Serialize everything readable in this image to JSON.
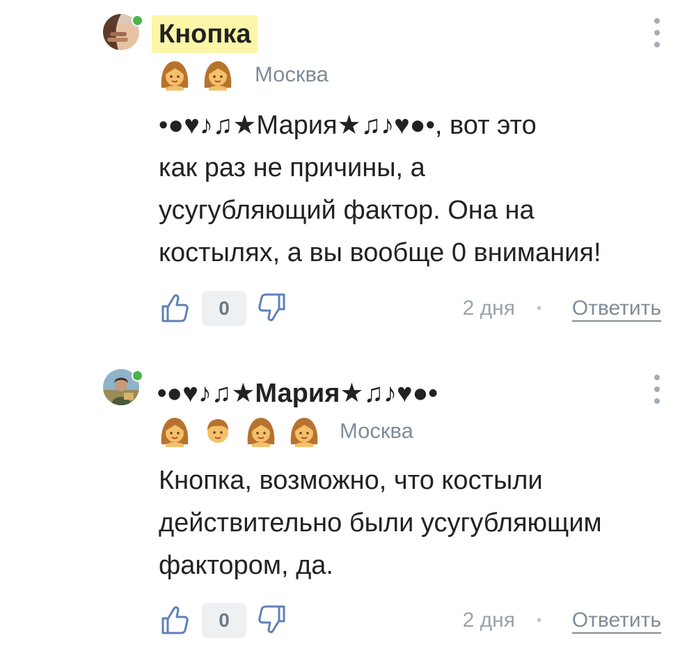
{
  "comments": [
    {
      "author": "Кнопка",
      "city": "Москва",
      "badge_icons": [
        "girl-badge-icon",
        "girl-badge-icon"
      ],
      "text_lines": [
        "•●♥♪♫★Мария★♫♪♥●•, вот это",
        "как раз не причины, а",
        "усугубляющий фактор. Она на",
        "костылях, а вы вообще 0 внимания!"
      ],
      "likes": "0",
      "time": "2 дня",
      "separator": "•",
      "reply_label": "Ответить"
    },
    {
      "author": "•●♥♪♫★Мария★♫♪♥●•",
      "city": "Москва",
      "badge_icons": [
        "girl-badge-icon",
        "boy-badge-icon",
        "girl-badge-icon",
        "girl-badge-icon"
      ],
      "text_lines": [
        "Кнопка, возможно, что костыли",
        "действительно были усугубляющим",
        "фактором, да."
      ],
      "likes": "0",
      "time": "2 дня",
      "separator": "•",
      "reply_label": "Ответить"
    }
  ],
  "colors": {
    "online": "#4bb34b",
    "highlight": "#fbf6a8",
    "muted": "#818c99",
    "text": "#222222"
  }
}
